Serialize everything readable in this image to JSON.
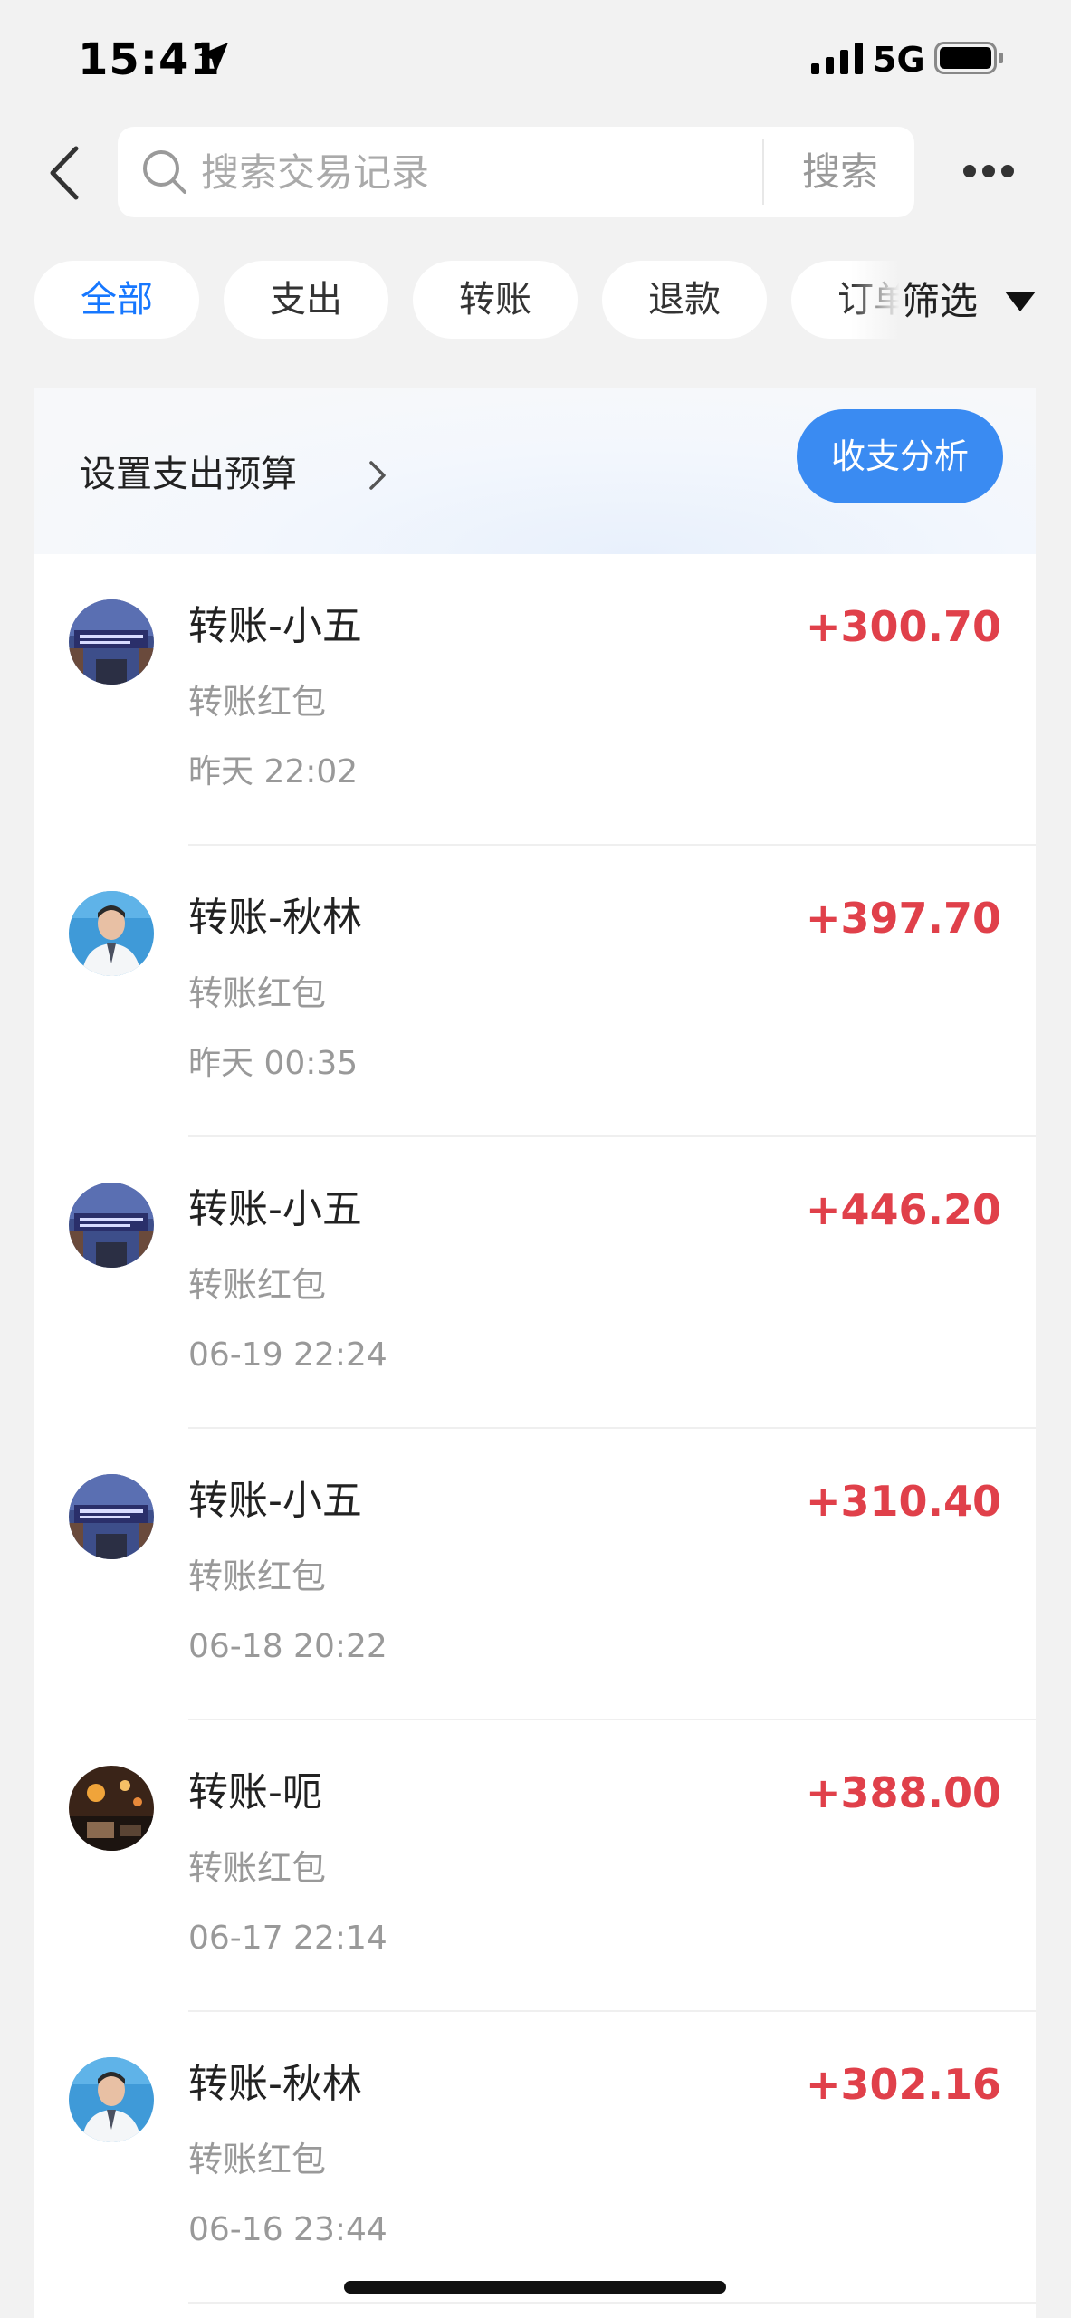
{
  "status_bar": {
    "time": "15:41",
    "network": "5G"
  },
  "header": {
    "search_placeholder": "搜索交易记录",
    "search_button": "搜索"
  },
  "filters": {
    "tabs": [
      {
        "label": "全部",
        "active": true
      },
      {
        "label": "支出",
        "active": false
      },
      {
        "label": "转账",
        "active": false
      },
      {
        "label": "退款",
        "active": false
      },
      {
        "label": "订单",
        "active": false
      }
    ],
    "filter_label": "筛选"
  },
  "summary": {
    "budget_label": "设置支出预算",
    "analysis_button": "收支分析"
  },
  "transactions": [
    {
      "title": "转账-小五",
      "subtitle": "转账红包",
      "time": "昨天 22:02",
      "amount": "+300.70",
      "avatar": "street-night-sign"
    },
    {
      "title": "转账-秋林",
      "subtitle": "转账红包",
      "time": "昨天 00:35",
      "amount": "+397.70",
      "avatar": "doctor-portrait"
    },
    {
      "title": "转账-小五",
      "subtitle": "转账红包",
      "time": "06-19 22:24",
      "amount": "+446.20",
      "avatar": "street-night-sign"
    },
    {
      "title": "转账-小五",
      "subtitle": "转账红包",
      "time": "06-18 20:22",
      "amount": "+310.40",
      "avatar": "street-night-sign"
    },
    {
      "title": "转账-呃",
      "subtitle": "转账红包",
      "time": "06-17 22:14",
      "amount": "+388.00",
      "avatar": "night-street-lights"
    },
    {
      "title": "转账-秋林",
      "subtitle": "转账红包",
      "time": "06-16 23:44",
      "amount": "+302.16",
      "avatar": "doctor-portrait"
    }
  ],
  "colors": {
    "accent": "#1677ff",
    "amount_income": "#e0404a",
    "analysis_button": "#3a8bf2",
    "background": "#f2f2f2"
  }
}
